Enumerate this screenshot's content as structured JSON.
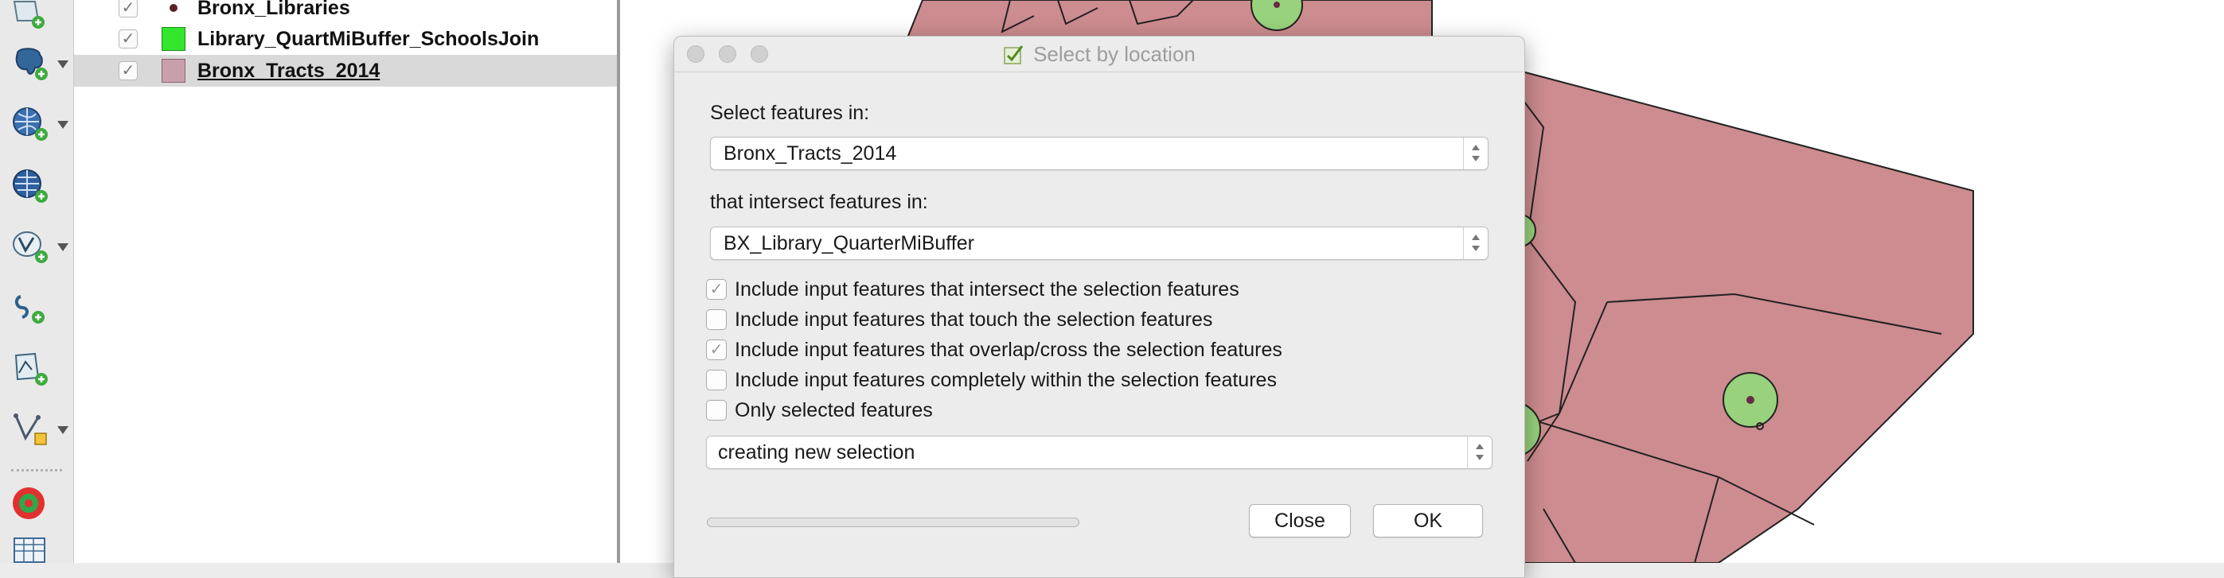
{
  "layers": [
    {
      "name": "Bronx_Libraries",
      "symbol": "point",
      "color": "#5a1f2b",
      "checked": true,
      "selected": false
    },
    {
      "name": "Library_QuartMiBuffer_SchoolsJoin",
      "symbol": "fill",
      "color": "#33e62e",
      "checked": true,
      "selected": false
    },
    {
      "name": "Bronx_Tracts_2014",
      "symbol": "fill",
      "color": "#c8a0ac",
      "checked": true,
      "selected": true
    }
  ],
  "toolbar": {
    "icons": [
      "add-vector-layer-icon",
      "add-postgis-layer-icon",
      "add-wms-layer-icon",
      "add-wfs-layer-icon",
      "add-virtual-layer-icon",
      "add-delimited-text-icon",
      "add-spatialite-icon",
      "add-vertex-layer-icon",
      "heatmap-plugin-icon",
      "table-icon"
    ]
  },
  "map": {
    "tract_fill": "#cd8c8f",
    "tract_stroke": "#222222",
    "buffer_fill": "#98d27c",
    "library_point": "#6b2a44"
  },
  "dialog": {
    "title": "Select by location",
    "select_features_label": "Select features in:",
    "select_layer": "Bronx_Tracts_2014",
    "intersect_label": "that intersect features in:",
    "intersect_layer": "BX_Library_QuarterMiBuffer",
    "options": [
      {
        "label": "Include input features that intersect the selection features",
        "checked": true,
        "enabled": false
      },
      {
        "label": "Include input features that touch the selection features",
        "checked": false,
        "enabled": true
      },
      {
        "label": "Include input features that overlap/cross the selection features",
        "checked": true,
        "enabled": false
      },
      {
        "label": "Include input features completely within the selection features",
        "checked": false,
        "enabled": true
      },
      {
        "label": "Only selected features",
        "checked": false,
        "enabled": true
      }
    ],
    "selection_mode": "creating new selection",
    "close_label": "Close",
    "ok_label": "OK"
  }
}
